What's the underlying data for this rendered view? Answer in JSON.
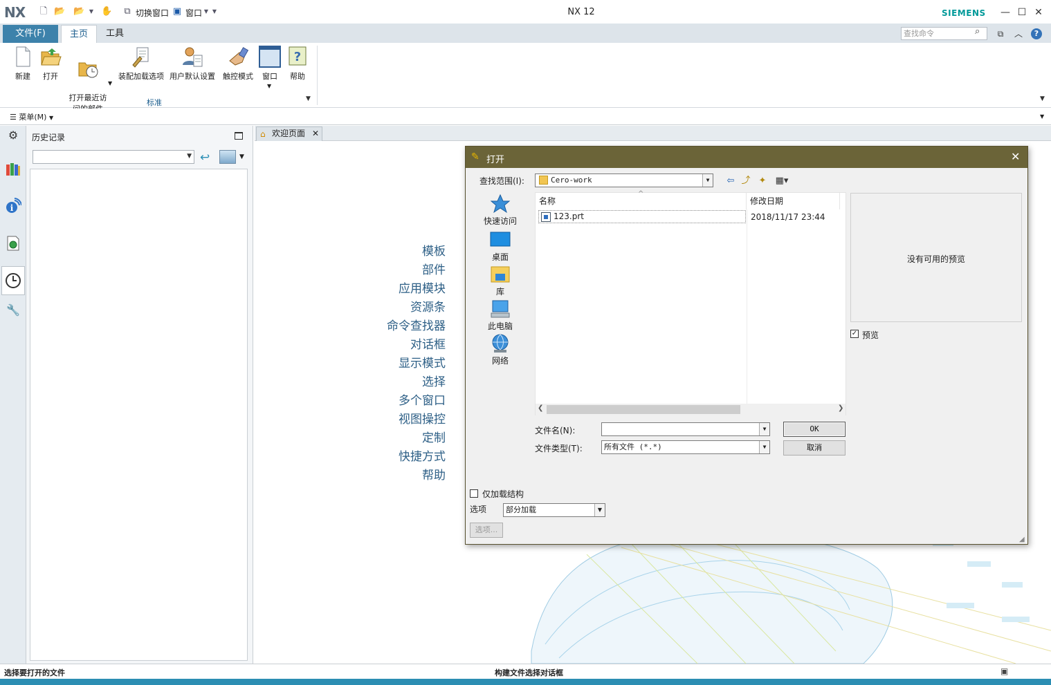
{
  "window": {
    "logo": "NX",
    "title": "NX 12",
    "brand": "SIEMENS",
    "quick_access": {
      "switch_window": "切换窗口",
      "window_menu": "窗口"
    }
  },
  "ribbon": {
    "tabs": [
      {
        "label": "文件(F)"
      },
      {
        "label": "主页"
      },
      {
        "label": "工具"
      }
    ],
    "search_placeholder": "查找命令",
    "buttons": [
      {
        "label": "新建"
      },
      {
        "label": "打开"
      },
      {
        "label": "打开最近访\n问的部件"
      },
      {
        "label": "装配加载选项"
      },
      {
        "label": "用户默认设置"
      },
      {
        "label": "触控模式"
      },
      {
        "label": "窗口"
      },
      {
        "label": "帮助"
      }
    ],
    "group_label": "标准"
  },
  "menubar": {
    "menu_label": "菜单(M)"
  },
  "history_panel": {
    "title": "历史记录"
  },
  "graphics": {
    "tab_label": "欢迎页面",
    "welcome_links": [
      "模板",
      "部件",
      "应用模块",
      "资源条",
      "命令查找器",
      "对话框",
      "显示模式",
      "选择",
      "多个窗口",
      "视图操控",
      "定制",
      "快捷方式",
      "帮助"
    ]
  },
  "dialog": {
    "title": "打开",
    "look_in_label": "查找范围(I):",
    "look_in_value": "Cero-work",
    "places": [
      "快速访问",
      "桌面",
      "库",
      "此电脑",
      "网络"
    ],
    "columns": [
      "名称",
      "修改日期"
    ],
    "files": [
      {
        "name": "123.prt",
        "modified": "2018/11/17 23:44"
      }
    ],
    "preview_text": "没有可用的预览",
    "preview_checkbox": "预览",
    "filename_label": "文件名(N):",
    "filename_value": "",
    "filetype_label": "文件类型(T):",
    "filetype_value": "所有文件 (*.*)",
    "ok_label": "OK",
    "cancel_label": "取消",
    "structure_only_label": "仅加载结构",
    "options_label": "选项",
    "options_value": "部分加载",
    "options_button": "选项..."
  },
  "status": {
    "left": "选择要打开的文件",
    "middle": "构建文件选择对话框"
  },
  "colors": {
    "file_tab": "#3d82ab",
    "dialog_title": "#6b6438",
    "brand": "#009999",
    "link": "#2d5f86"
  }
}
